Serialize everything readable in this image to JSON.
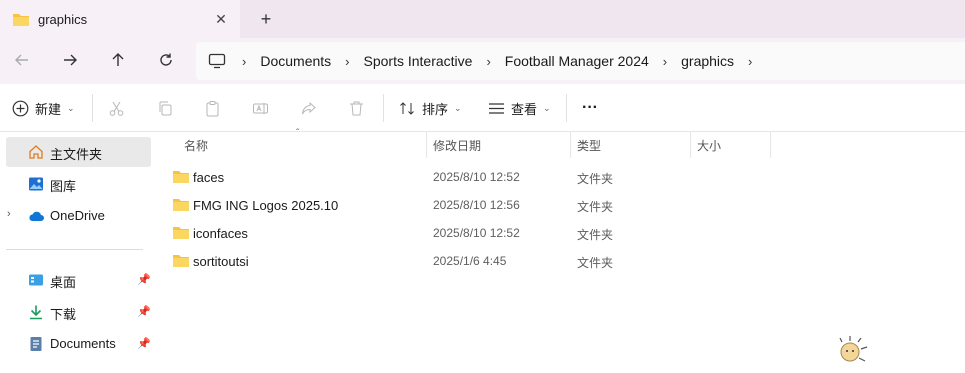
{
  "tab": {
    "title": "graphics",
    "close_glyph": "✕",
    "new_tab_glyph": "+"
  },
  "breadcrumb": {
    "items": [
      "Documents",
      "Sports Interactive",
      "Football Manager 2024",
      "graphics"
    ],
    "separator": "›"
  },
  "commandbar": {
    "new_label": "新建",
    "sort_label": "排序",
    "view_label": "查看",
    "more_glyph": "···"
  },
  "sidebar": {
    "items": [
      {
        "label": "主文件夹",
        "icon": "home-icon",
        "selected": true
      },
      {
        "label": "图库",
        "icon": "gallery-icon"
      },
      {
        "label": "OneDrive",
        "icon": "cloud-icon",
        "expandable": true
      },
      {
        "label": "桌面",
        "icon": "desktop-icon",
        "pinned": true
      },
      {
        "label": "下载",
        "icon": "download-icon",
        "pinned": true
      },
      {
        "label": "Documents",
        "icon": "documents-icon",
        "pinned": true
      }
    ]
  },
  "columns": {
    "name": "名称",
    "date": "修改日期",
    "type": "类型",
    "size": "大小"
  },
  "files": [
    {
      "name": "faces",
      "date": "2025/8/10 12:52",
      "type": "文件夹"
    },
    {
      "name": "FMG ING Logos 2025.10",
      "date": "2025/8/10 12:56",
      "type": "文件夹"
    },
    {
      "name": "iconfaces",
      "date": "2025/8/10 12:52",
      "type": "文件夹"
    },
    {
      "name": "sortitoutsi",
      "date": "2025/1/6 4:45",
      "type": "文件夹"
    }
  ],
  "colors": {
    "accent": "#0067c0",
    "folder": "#f6c343",
    "tab_bg": "#f7f1f7",
    "strip_bg": "#efe6ef"
  }
}
